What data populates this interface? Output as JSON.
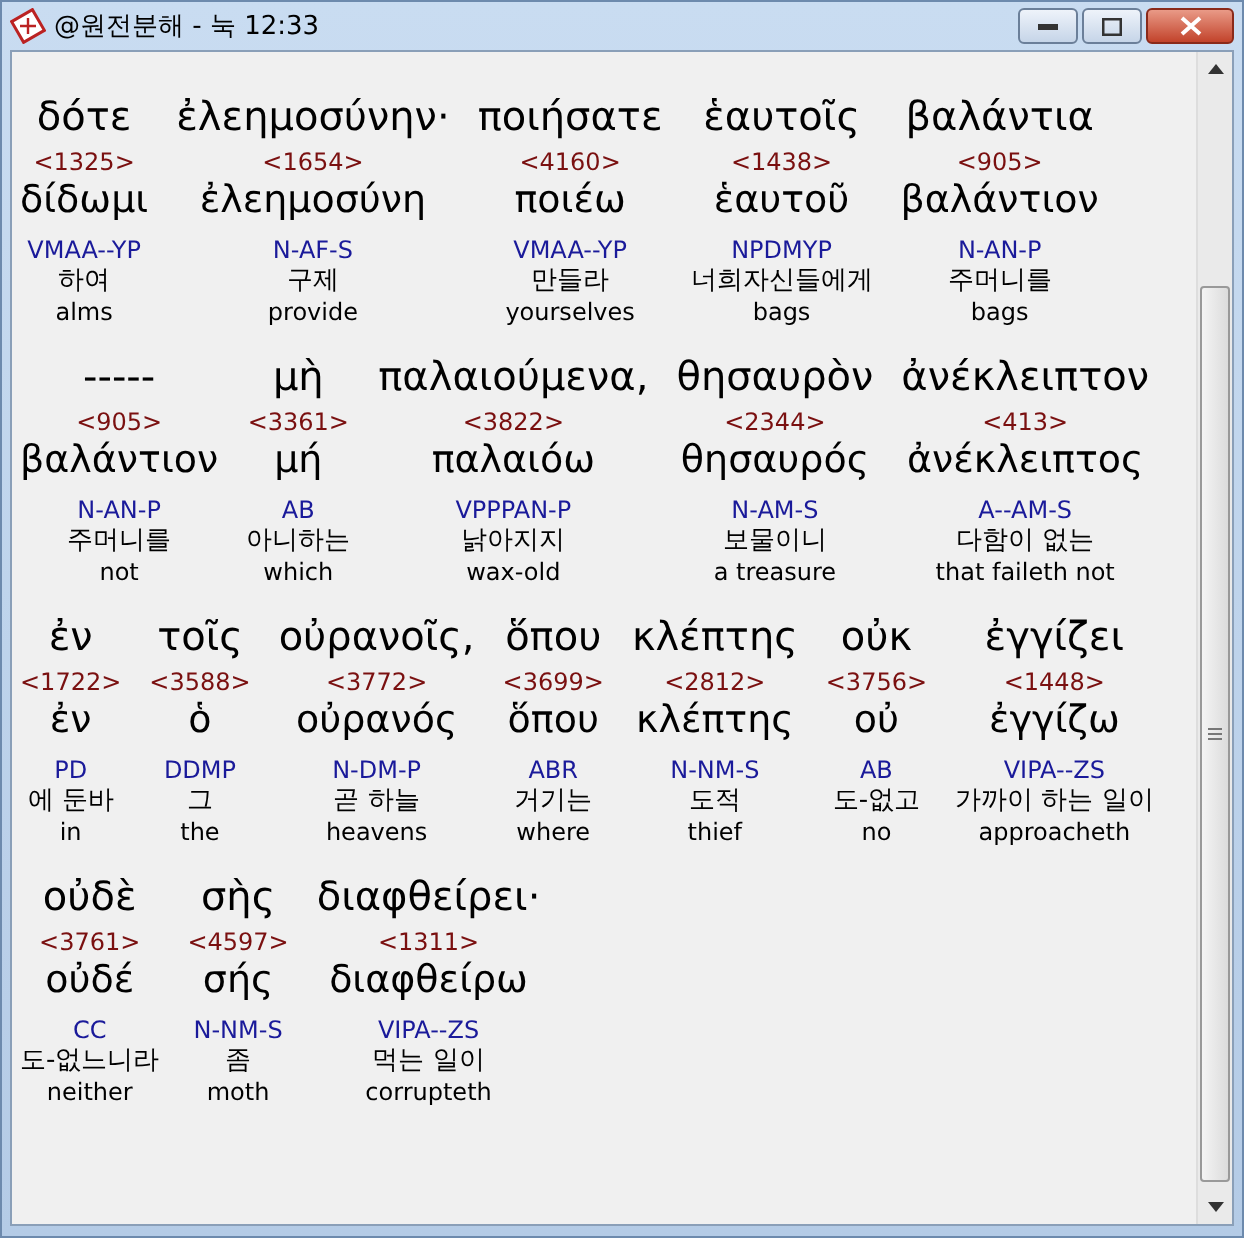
{
  "window": {
    "title": "@원전분해 - 눅 12:33"
  },
  "rows": [
    {
      "words": [
        {
          "greek": "δότε",
          "strongs": "<1325>",
          "lemma": "δίδωμι",
          "parse": "VMAA--YP",
          "korean": "하여",
          "english": "alms"
        },
        {
          "greek": "ἐλεημοσύνην·",
          "strongs": "<1654>",
          "lemma": "ἐλεημοσύνη",
          "parse": "N-AF-S",
          "korean": "구제",
          "english": "provide"
        },
        {
          "greek": "ποιήσατε",
          "strongs": "<4160>",
          "lemma": "ποιέω",
          "parse": "VMAA--YP",
          "korean": "만들라",
          "english": "yourselves"
        },
        {
          "greek": "ἑαυτοῖς",
          "strongs": "<1438>",
          "lemma": "ἑαυτοῦ",
          "parse": "NPDMYP",
          "korean": "너희자신들에게",
          "english": "bags"
        },
        {
          "greek": "βαλάντια",
          "strongs": "<905>",
          "lemma": "βαλάντιον",
          "parse": "N-AN-P",
          "korean": "주머니를",
          "english": "bags"
        }
      ]
    },
    {
      "words": [
        {
          "greek": "-----",
          "strongs": "<905>",
          "lemma": "βαλάντιον",
          "parse": "N-AN-P",
          "korean": "주머니를",
          "english": "not"
        },
        {
          "greek": "μὴ",
          "strongs": "<3361>",
          "lemma": "μή",
          "parse": "AB",
          "korean": "아니하는",
          "english": "which"
        },
        {
          "greek": "παλαιούμενα,",
          "strongs": "<3822>",
          "lemma": "παλαιόω",
          "parse": "VPPPAN-P",
          "korean": "낡아지지",
          "english": "wax-old"
        },
        {
          "greek": "θησαυρὸν",
          "strongs": "<2344>",
          "lemma": "θησαυρός",
          "parse": "N-AM-S",
          "korean": "보물이니",
          "english": "a treasure"
        },
        {
          "greek": "ἀνέκλειπτον",
          "strongs": "<413>",
          "lemma": "ἀνέκλειπτος",
          "parse": "A--AM-S",
          "korean": "다함이 없는",
          "english": "that faileth not"
        }
      ]
    },
    {
      "words": [
        {
          "greek": "ἐν",
          "strongs": "<1722>",
          "lemma": "ἐν",
          "parse": "PD",
          "korean": "에 둔바",
          "english": "in"
        },
        {
          "greek": "τοῖς",
          "strongs": "<3588>",
          "lemma": "ὁ",
          "parse": "DDMP",
          "korean": "그",
          "english": "the"
        },
        {
          "greek": "οὐρανοῖς,",
          "strongs": "<3772>",
          "lemma": "οὐρανός",
          "parse": "N-DM-P",
          "korean": "곧 하늘",
          "english": "heavens"
        },
        {
          "greek": "ὅπου",
          "strongs": "<3699>",
          "lemma": "ὅπου",
          "parse": "ABR",
          "korean": "거기는",
          "english": "where"
        },
        {
          "greek": "κλέπτης",
          "strongs": "<2812>",
          "lemma": "κλέπτης",
          "parse": "N-NM-S",
          "korean": "도적",
          "english": "thief"
        },
        {
          "greek": "οὐκ",
          "strongs": "<3756>",
          "lemma": "οὐ",
          "parse": "AB",
          "korean": "도-없고",
          "english": "no"
        },
        {
          "greek": "ἐγγίζει",
          "strongs": "<1448>",
          "lemma": "ἐγγίζω",
          "parse": "VIPA--ZS",
          "korean": "가까이 하는 일이",
          "english": "approacheth"
        }
      ]
    },
    {
      "words": [
        {
          "greek": "οὐδὲ",
          "strongs": "<3761>",
          "lemma": "οὐδέ",
          "parse": "CC",
          "korean": "도-없느니라",
          "english": "neither"
        },
        {
          "greek": "σὴς",
          "strongs": "<4597>",
          "lemma": "σής",
          "parse": "N-NM-S",
          "korean": "좀",
          "english": "moth"
        },
        {
          "greek": "διαφθείρει·",
          "strongs": "<1311>",
          "lemma": "διαφθείρω",
          "parse": "VIPA--ZS",
          "korean": "먹는 일이",
          "english": "corrupteth"
        }
      ]
    }
  ]
}
